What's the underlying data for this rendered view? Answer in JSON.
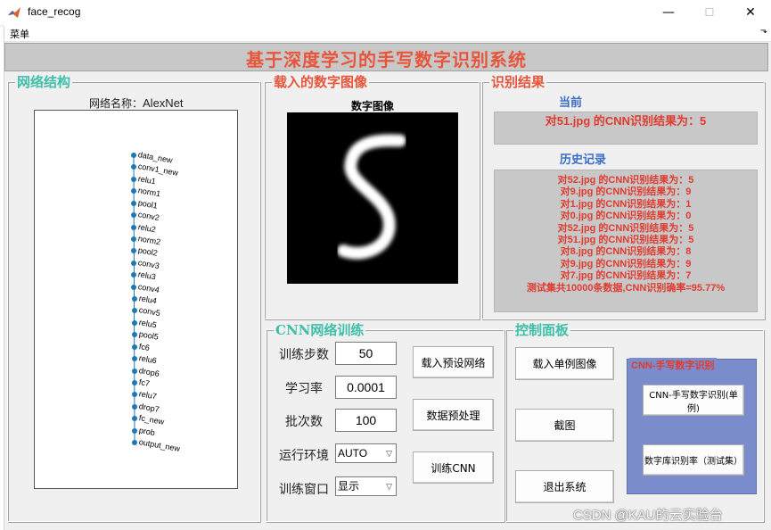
{
  "window": {
    "title": "face_recog",
    "min": "—",
    "max": "☐",
    "close": "✕"
  },
  "menu": {
    "label": "菜单",
    "arrow": "⬎"
  },
  "header": {
    "title": "基于深度学习的手写数字识别系统"
  },
  "network": {
    "panel_title": "网络结构",
    "name_label": "网络名称：",
    "name_value": "AlexNet",
    "layers": [
      "data_new",
      "conv1_new",
      "relu1",
      "norm1",
      "pool1",
      "conv2",
      "relu2",
      "norm2",
      "pool2",
      "conv3",
      "relu3",
      "conv4",
      "relu4",
      "conv5",
      "relu5",
      "pool5",
      "fc6",
      "relu6",
      "drop6",
      "fc7",
      "relu7",
      "drop7",
      "fc_new",
      "prob",
      "output_new"
    ]
  },
  "image": {
    "panel_title": "载入的数字图像",
    "caption": "数字图像"
  },
  "result": {
    "panel_title": "识别结果",
    "current_label": "当前",
    "current_text": "对51.jpg 的CNN识别结果为：5",
    "history_label": "历史记录",
    "history": [
      "对52.jpg 的CNN识别结果为：5",
      "对9.jpg 的CNN识别结果为：9",
      "对1.jpg 的CNN识别结果为：1",
      "对0.jpg 的CNN识别结果为：0",
      "对52.jpg 的CNN识别结果为：5",
      "对51.jpg 的CNN识别结果为：5",
      "对8.jpg 的CNN识别结果为：8",
      "对9.jpg 的CNN识别结果为：9",
      "对7.jpg 的CNN识别结果为：7",
      "测试集共10000条数据,CNN识别确率=95.77%"
    ]
  },
  "training": {
    "panel_title": "CNN网络训练",
    "steps_label": "训练步数",
    "steps_value": "50",
    "lr_label": "学习率",
    "lr_value": "0.0001",
    "batch_label": "批次数",
    "batch_value": "100",
    "env_label": "运行环境",
    "env_value": "AUTO",
    "window_label": "训练窗口",
    "window_value": "显示",
    "btn_load_net": "载入预设网络",
    "btn_preprocess": "数据预处理",
    "btn_train": "训练CNN"
  },
  "control": {
    "panel_title": "控制面板",
    "btn_load_image": "载入单例图像",
    "btn_screenshot": "截图",
    "btn_exit": "退出系统",
    "group_title": "CNN-手写数字识别",
    "btn_single": "CNN-手写数字识别(单例)",
    "btn_batch": "数字库识别率（测试集）"
  },
  "watermark": "CSDN @KAU的云实验台",
  "colors": {
    "accent_red": "#e8553b",
    "teal": "#3fbfa8",
    "blue_title": "#3b6cc8",
    "group_bg": "#7b8ccc",
    "group_title": "#e03b2f"
  }
}
